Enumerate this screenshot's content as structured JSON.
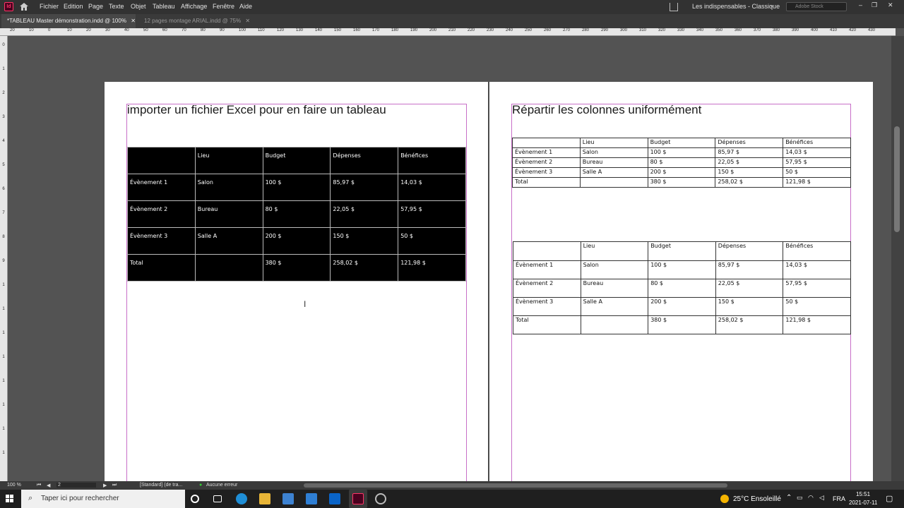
{
  "menubar": {
    "items": [
      "Fichier",
      "Edition",
      "Page",
      "Texte",
      "Objet",
      "Tableau",
      "Affichage",
      "Fenêtre",
      "Aide"
    ],
    "workspace": "Les indispensables - Classique",
    "search_placeholder": "Adobe Stock",
    "app_logo": "Id"
  },
  "tabs": [
    {
      "label": "*TABLEAU Master démonstration.indd @ 100%",
      "active": true
    },
    {
      "label": "12 pages montage ARIAL.indd @ 75%",
      "active": false
    }
  ],
  "ruler": {
    "h": [
      "20",
      "10",
      "0",
      "10",
      "20",
      "30",
      "40",
      "50",
      "60",
      "70",
      "80",
      "90",
      "100",
      "110",
      "120",
      "130",
      "140",
      "150",
      "160",
      "170",
      "180",
      "190",
      "200",
      "210",
      "220",
      "230",
      "240",
      "250",
      "260",
      "270",
      "280",
      "290",
      "300",
      "310",
      "320",
      "330",
      "340",
      "350",
      "360",
      "370",
      "380",
      "390",
      "400",
      "410",
      "420",
      "430"
    ],
    "v": [
      "0",
      "1",
      "2",
      "3",
      "4",
      "5",
      "6",
      "7",
      "8",
      "9",
      "1",
      "1",
      "1",
      "1",
      "1",
      "1",
      "1",
      "1"
    ]
  },
  "left_page": {
    "title": "importer un fichier Excel pour en faire un tableau",
    "table": [
      [
        "",
        "Lieu",
        "Budget",
        "Dépenses",
        "Bénéfices"
      ],
      [
        "Évènement 1",
        "Salon",
        "100 $",
        "85,97 $",
        "14,03 $"
      ],
      [
        "Évènement 2",
        "Bureau",
        "80 $",
        "22,05 $",
        "57,95 $"
      ],
      [
        "Évènement 3",
        "Salle A",
        "200 $",
        "150 $",
        "50 $"
      ],
      [
        "Total",
        "",
        "380 $",
        "258,02 $",
        "121,98 $"
      ]
    ]
  },
  "right_page": {
    "title": "Répartir les colonnes uniformément",
    "table1": [
      [
        "",
        "Lieu",
        "Budget",
        "Dépenses",
        "Bénéfices"
      ],
      [
        "Évènement 1",
        "Salon",
        "100 $",
        "85,97 $",
        "14,03 $"
      ],
      [
        "Évènement 2",
        "Bureau",
        "80 $",
        "22,05 $",
        "57,95 $"
      ],
      [
        "Évènement 3",
        "Salle A",
        "200 $",
        "150 $",
        "50 $"
      ],
      [
        "Total",
        "",
        "380 $",
        "258,02 $",
        "121,98 $"
      ]
    ],
    "table2": [
      [
        "",
        "Lieu",
        "Budget",
        "Dépenses",
        "Bénéfices"
      ],
      [
        "Évènement 1",
        "Salon",
        "100 $",
        "85,97 $",
        "14,03 $"
      ],
      [
        "Évènement 2",
        "Bureau",
        "80 $",
        "22,05 $",
        "57,95 $"
      ],
      [
        "Évènement 3",
        "Salle A",
        "200 $",
        "150 $",
        "50 $"
      ],
      [
        "Total",
        "",
        "380 $",
        "258,02 $",
        "121,98 $"
      ]
    ]
  },
  "status": {
    "zoom": "100 %",
    "page": "2",
    "preflight_profile": "[Standard] (de tra...",
    "errors": "Aucune erreur"
  },
  "taskbar": {
    "search_placeholder": "Taper ici pour rechercher",
    "weather": "25°C Ensoleillé",
    "lang": "FRA",
    "time": "15:51",
    "date": "2021-07-11"
  }
}
